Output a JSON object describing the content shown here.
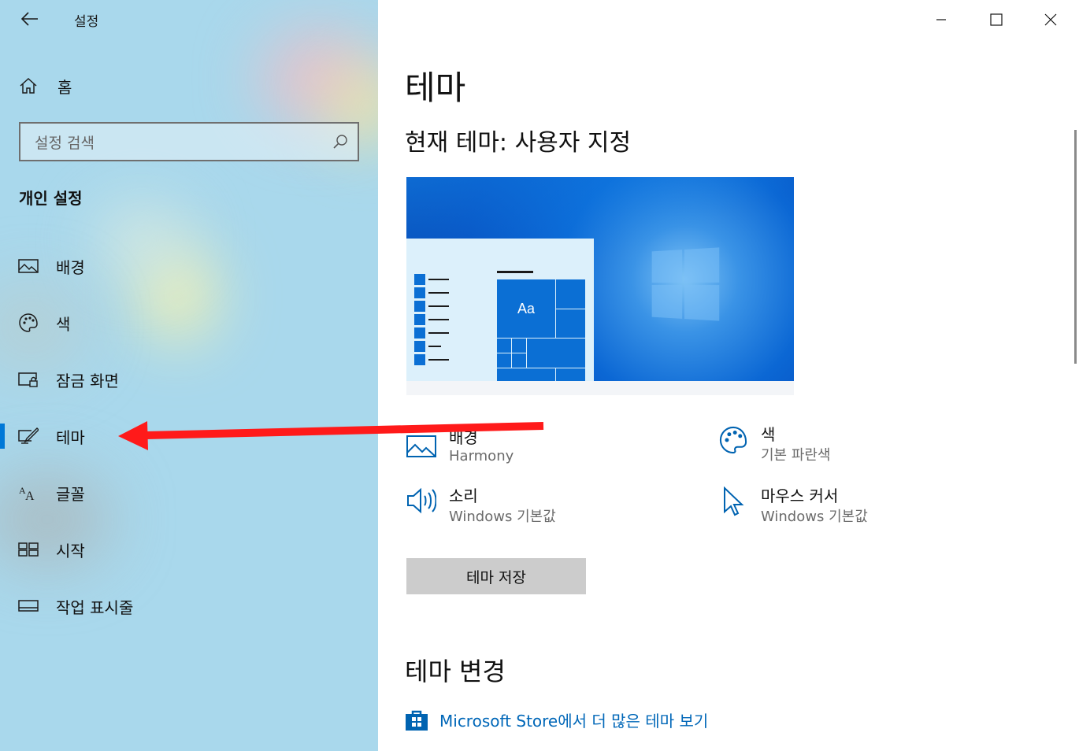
{
  "window": {
    "title": "설정",
    "controls": [
      "minimize",
      "maximize",
      "close"
    ]
  },
  "sidebar": {
    "home_label": "홈",
    "search_placeholder": "설정 검색",
    "section_title": "개인 설정",
    "items": [
      {
        "label": "배경",
        "icon": "picture-icon"
      },
      {
        "label": "색",
        "icon": "palette-icon"
      },
      {
        "label": "잠금 화면",
        "icon": "lock-screen-icon"
      },
      {
        "label": "테마",
        "icon": "theme-brush-icon",
        "selected": true
      },
      {
        "label": "글꼴",
        "icon": "font-icon"
      },
      {
        "label": "시작",
        "icon": "start-tiles-icon"
      },
      {
        "label": "작업 표시줄",
        "icon": "taskbar-icon"
      }
    ]
  },
  "main": {
    "title": "테마",
    "current_theme": "현재 테마: 사용자 지정",
    "preview": {
      "tile_text": "Aa"
    },
    "options": [
      {
        "name": "배경",
        "value": "Harmony",
        "icon": "picture-icon"
      },
      {
        "name": "색",
        "value": "기본 파란색",
        "icon": "palette-icon"
      },
      {
        "name": "소리",
        "value": "Windows 기본값",
        "icon": "speaker-icon"
      },
      {
        "name": "마우스 커서",
        "value": "Windows 기본값",
        "icon": "mouse-cursor-icon"
      }
    ],
    "save_button": "테마 저장",
    "change_heading": "테마 변경",
    "store_link": "Microsoft Store에서 더 많은 테마 보기"
  },
  "colors": {
    "accent": "#0078d7",
    "link": "#0067b8",
    "annotation_arrow": "#ff0000"
  }
}
